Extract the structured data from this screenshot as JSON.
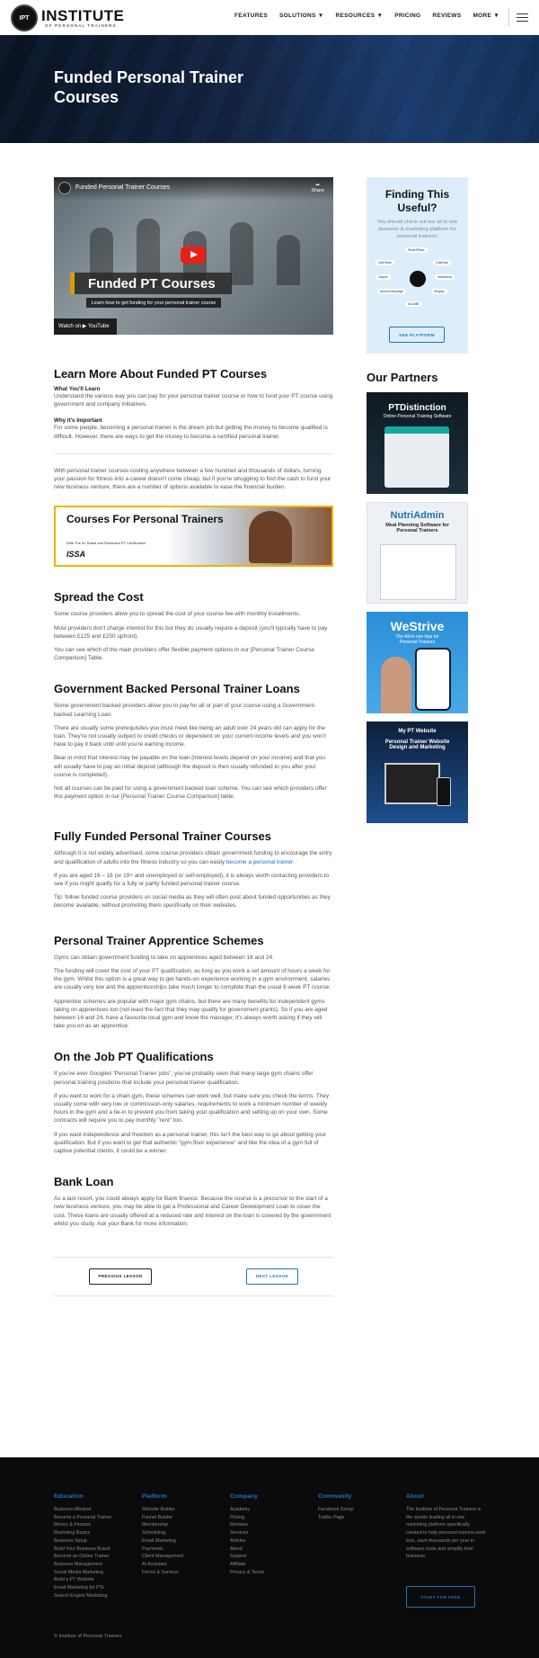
{
  "header": {
    "logo_badge": "IPT",
    "logo_name": "INSTITUTE",
    "logo_sub": "OF PERSONAL TRAINERS",
    "nav": [
      "FEATURES",
      "SOLUTIONS ▼",
      "RESOURCES ▼",
      "PRICING",
      "REVIEWS",
      "MORE ▼"
    ]
  },
  "hero": {
    "title": "Funded Personal Trainer Courses"
  },
  "video": {
    "top_title": "Funded Personal Trainer Courses",
    "share": "Share",
    "band_title": "Funded PT Courses",
    "subtitle": "Learn how to get funding for your personal trainer course",
    "watch": "Watch on ▶ YouTube"
  },
  "learn": {
    "heading": "Learn More About Funded PT Courses",
    "what_label": "What You'll Learn",
    "what_text": "Understand the various way you can pay for your personal trainer course or how to fund your PT course using government and company initiatives.",
    "why_label": "Why it's Important",
    "why_text": "For some people, becoming a personal trainer is the dream job but getting the money to become qualified is difficult. However, there are ways to get the money to become a certified personal trainer."
  },
  "intro": "With personal trainer courses costing anywhere between a few hundred and thousands of dollars, turning your passion for fitness into a career doesn't come cheap, but if you're struggling to find the cash to fund your new business venture, there are a number of options available to ease the financial burden.",
  "banner": {
    "title": "Courses For Personal Trainers",
    "tag": "With The #1 Rated and Reviewed PT Certification",
    "logo": "ISSA"
  },
  "spread": {
    "heading": "Spread the Cost",
    "p1": "Some course providers allow you to spread the cost of your course fee with monthly installments.",
    "p2": "Most providers don't charge interest for this but they do usually require a deposit (you'll typically have to pay between £125 and £250 upfront).",
    "p3": "You can see which of the main providers offer flexible payment options in our [Personal Trainer Course Comparison] Table."
  },
  "gov": {
    "heading": "Government Backed Personal Trainer Loans",
    "p1": "Some government backed providers allow you to pay for all or part of your course using a Government-backed Learning Loan.",
    "p2": "There are usually some prerequisites you must meet like being an adult over 24 years old can apply for the loan. They're not usually subject to credit checks or dependent on your current income levels and you won't have to pay it back until until you're earning income.",
    "p3": "Bear in mind that interest may be payable on the loan (interest levels depend on your income) and that you will usually have to pay an initial deposit (although the deposit is then usually refunded to you after your course is completed).",
    "p4": "Not all courses can be paid for using a government backed loan scheme. You can see which providers offer this payment option in our [Personal Trainer Course Comparison] table."
  },
  "fully": {
    "heading": "Fully Funded Personal Trainer Courses",
    "p1": "Although it is not widely advertised, some course providers obtain government funding to encourage the entry and qualification of adults into the fitness industry so you can easily",
    "p1_link": "become a personal trainer.",
    "p2": "If you are aged 16 – 18 (or 19+ and unemployed or self-employed), it is always worth contacting providers to see if you might qualify for a fully or partly funded personal trainer course.",
    "p3": "Tip: follow funded course providers on social media as they will often post about funded opportunities as they become available, without promoting them specifically on their websites."
  },
  "apprentice": {
    "heading": "Personal Trainer Apprentice Schemes",
    "p1": "Gyms can obtain government funding to take on apprentices aged between 16 and 24.",
    "p2": "The funding will cover the cost of your PT qualification, as long as you work a set amount of hours a week for the gym.  Whilst this option is a great way to get hands-on experience working in a gym environment, salaries are usually very low and the apprenticeships take much longer to complete than the usual 6 week PT course.",
    "p3": "Apprentice schemes are popular with major gym chains, but there are many benefits for independent gyms taking on apprentices too (not least the fact that they may qualify for government grants). So if you are aged between 16 and 24, have a favourite local gym and know the manager, it's always worth asking if they will take you on as an apprentice."
  },
  "job": {
    "heading": "On the Job PT Qualifications",
    "p1": "If you've ever Googled \"Personal Trainer jobs\", you've probably seen that many large gym chains offer personal training positions that include your personal trainer qualification.",
    "p2": "If you want to work for a chain gym, these schemes can work well, but make sure you check the terms. They usually come with very low or commission-only salaries, requirements to work a minimum number of weekly hours in the gym and a tie-in to prevent you from taking your qualification and setting up on your own. Some contracts will require you to pay monthly \"rent\" too.",
    "p3": "If you want independence and freedom as a personal trainer, this isn't the best way to go about getting your qualification. But if you want to get that authentic \"gym floor experience\" and like the idea of a gym full of captive potential clients, it could be a winner."
  },
  "bank": {
    "heading": "Bank Loan",
    "p1": "As a last resort, you could always apply for Bank finance. Because the course is a precursor to the start of a new business venture, you may be able to get a Professional and Career Development Loan to cover the cost. These loans are usually offered at a reduced rate and interest on the loan is covered by the government whilst you study. Ask your Bank for more information."
  },
  "pager": {
    "prev": "PREVIOUS LESSON",
    "next": "NEXT LESSON"
  },
  "sidebar": {
    "finding_title": "Finding This Useful?",
    "finding_text": "You should check out our all in one business & marketing platform for personal trainers!",
    "hub_items": [
      "SmartPlace",
      "Calendly",
      "UberEats",
      "mailchimp",
      "Jasper",
      "Shopify",
      "ActiveCampaign",
      "KAJABI"
    ],
    "platform_button": "SEE PLATFORM",
    "partners_heading": "Our Partners",
    "partners": [
      {
        "title": "PTDistinction",
        "sub": "Online Personal Training Software"
      },
      {
        "title": "NutriAdmin",
        "sub": "Meal Planning Software for Personal Trainers"
      },
      {
        "title": "WeStrive",
        "sub": "The All-in-one App for Personal Trainers"
      },
      {
        "title": "My PT Website",
        "sub": "Personal Trainer Website Design and Marketing"
      }
    ]
  },
  "footer": {
    "cols": [
      {
        "title": "Education",
        "links": [
          "Business Mindset",
          "Become a Personal Trainer",
          "Money & Finance",
          "Marketing Basics",
          "Business Setup",
          "Build Your Business Brand",
          "Become an Online Trainer",
          "Business Management",
          "Social Media Marketing",
          "Build a PT Website",
          "Email Marketing for PTs",
          "Search Engine Marketing"
        ]
      },
      {
        "title": "Platform",
        "links": [
          "Website Builder",
          "Funnel Builder",
          "Membership",
          "Scheduling",
          "Email Marketing",
          "Payments",
          "Client Management",
          "AI Assistant",
          "Forms & Surveys"
        ]
      },
      {
        "title": "Company",
        "links": [
          "Academy",
          "Pricing",
          "Reviews",
          "Services",
          "Articles",
          "About",
          "Support",
          "Affiliate",
          "Privacy & Terms"
        ]
      },
      {
        "title": "Community",
        "links": [
          "Facebook Group",
          "Twitter Page"
        ]
      }
    ],
    "about_title": "About",
    "about_text": "The Institute of Personal Trainers is the worlds leading all in one marketing platform specifically created to help personal trainers work less, save thousands per year in software costs and simplify their business.",
    "start_button": "START FOR FREE",
    "copyright": "© Institute of Personal Trainers"
  },
  "colors": {
    "accent": "#1e73be",
    "banner_border": "#f0b400",
    "footer_bg": "#0b0b0b",
    "sidebar_bg": "#ddeefa"
  }
}
